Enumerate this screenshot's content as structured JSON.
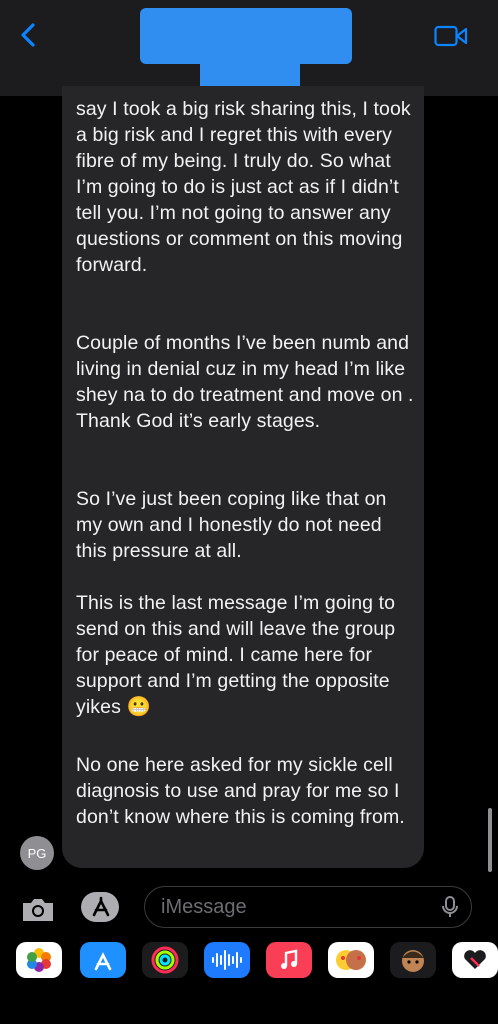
{
  "header": {
    "back_icon": "chevron-left-icon",
    "video_icon": "video-camera-icon"
  },
  "message": {
    "paragraphs": [
      "say I took a big risk sharing this, I took a big risk and I regret this with every fibre of my being. I truly do. So what I’m going to do is just act as if I didn’t tell you. I’m not going to answer any questions or comment on this moving forward.",
      "Couple of months I’ve been numb and living in denial cuz in my head I’m like shey na to do treatment and move on . Thank God it’s early stages.",
      "So I’ve just been coping like that on my own and I honestly do not need this pressure at all.",
      "This is the last message I’m going to send on this and will leave the group for peace of mind. I came here for support and I’m getting the opposite yikes 😬",
      "No one here asked for my sickle cell diagnosis to use and pray for me so I don’t know where this is coming from."
    ],
    "sender_initials": "PG"
  },
  "compose": {
    "placeholder": "iMessage",
    "camera_icon": "camera-icon",
    "apps_icon": "app-store-icon",
    "mic_icon": "microphone-icon"
  },
  "app_drawer": [
    {
      "name": "photos",
      "icon": "photos-icon"
    },
    {
      "name": "app-store",
      "icon": "app-store-icon"
    },
    {
      "name": "activity",
      "icon": "activity-rings-icon"
    },
    {
      "name": "audio",
      "icon": "audio-waveform-icon"
    },
    {
      "name": "music",
      "icon": "music-note-icon"
    },
    {
      "name": "memoji-stickers",
      "icon": "memoji-stickers-icon"
    },
    {
      "name": "memoji",
      "icon": "memoji-icon"
    },
    {
      "name": "digital-touch",
      "icon": "heart-icon"
    }
  ],
  "colors": {
    "accent": "#0a84ff",
    "bubble": "#262629",
    "header": "#1c1c1e"
  }
}
